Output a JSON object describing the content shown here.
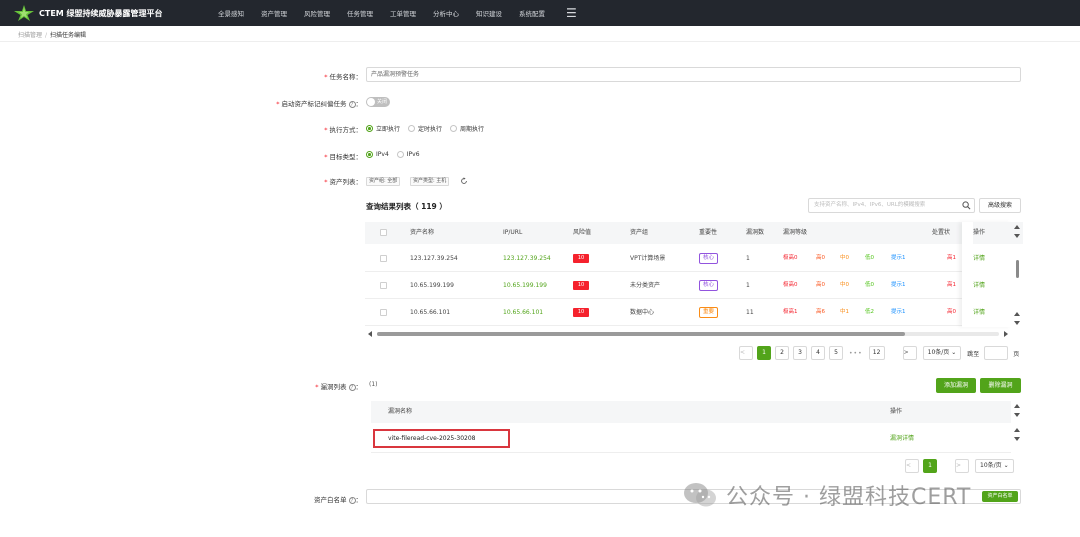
{
  "app": {
    "brand": "CTEM 绿盟持续威胁暴露管理平台",
    "nav": [
      "全景感知",
      "资产管理",
      "风险管理",
      "任务管理",
      "工单管理",
      "分析中心",
      "知识建设",
      "系统配置"
    ]
  },
  "breadcrumb": {
    "parent": "扫描管理",
    "separator": "/",
    "current": "扫描任务编辑"
  },
  "form": {
    "task_name": {
      "label": "任务名称",
      "value": "产品漏洞预警任务"
    },
    "asset_tag": {
      "label": "启动资产标记纠偏任务",
      "toggle_text": "关闭",
      "enabled": false
    },
    "exec_mode": {
      "label": "执行方式",
      "options": [
        "立即执行",
        "定时执行",
        "周期执行"
      ],
      "selected": 0
    },
    "target_type": {
      "label": "目标类型",
      "options": [
        "IPv4",
        "IPv6"
      ],
      "selected": 0
    },
    "asset_list": {
      "label": "资产列表",
      "tags": [
        "资产组: 全部",
        "资产类型: 主机"
      ]
    }
  },
  "results": {
    "title": "查询结果列表",
    "count": "（ 119 ）",
    "search_placeholder": "支持资产名称、IPv4、IPv6、URL的模糊搜索",
    "advanced_search": "高级搜索",
    "headers": [
      "资产名称",
      "IP/URL",
      "风险值",
      "资产组",
      "重要性",
      "漏洞数",
      "漏洞等级",
      "处置状",
      "操作"
    ],
    "rows": [
      {
        "name": "123.127.39.254",
        "ip": "123.127.39.254",
        "risk": "10",
        "group": "VPT计算场景",
        "importance": "核心",
        "imp_color": "#9254de",
        "vulns": "1",
        "levels": [
          "极高0",
          "高0",
          "中0",
          "低0",
          "提示1"
        ],
        "handle": "高1",
        "action": "详情"
      },
      {
        "name": "10.65.199.199",
        "ip": "10.65.199.199",
        "risk": "10",
        "group": "未分类资产",
        "importance": "核心",
        "imp_color": "#9254de",
        "vulns": "1",
        "levels": [
          "极高0",
          "高0",
          "中0",
          "低0",
          "提示1"
        ],
        "handle": "高1",
        "action": "详情"
      },
      {
        "name": "10.65.66.101",
        "ip": "10.65.66.101",
        "risk": "10",
        "group": "数据中心",
        "importance": "重要",
        "imp_color": "#fa8c16",
        "vulns": "11",
        "levels": [
          "极高1",
          "高6",
          "中1",
          "低2",
          "提示1"
        ],
        "handle": "高0",
        "action": "详情"
      }
    ],
    "level_colors": [
      "#f5222d",
      "#fa541c",
      "#fa8c16",
      "#52c41a",
      "#1890ff"
    ],
    "pagination": {
      "pages": [
        "1",
        "2",
        "3",
        "4",
        "5"
      ],
      "ellipsis": "•••",
      "last": "12",
      "prev": "<",
      "next": ">",
      "page_size": "10条/页",
      "jump_label": "跳至",
      "jump_suffix": "页",
      "current": "1"
    }
  },
  "vuln": {
    "label": "漏洞列表",
    "count": "(1)",
    "add_button": "添加漏洞",
    "delete_button": "删除漏洞",
    "headers": [
      "漏洞名称",
      "操作"
    ],
    "rows": [
      {
        "name": "vite-fileread-cve-2025-30208",
        "action": "漏洞详情"
      }
    ],
    "pagination": {
      "prev": "<",
      "current": "1",
      "next": ">",
      "page_size": "10条/页"
    }
  },
  "whitelist": {
    "label": "资产白名单",
    "button": "资产白名单"
  },
  "watermark": {
    "text": "公众号 · 绿盟科技CERT"
  }
}
